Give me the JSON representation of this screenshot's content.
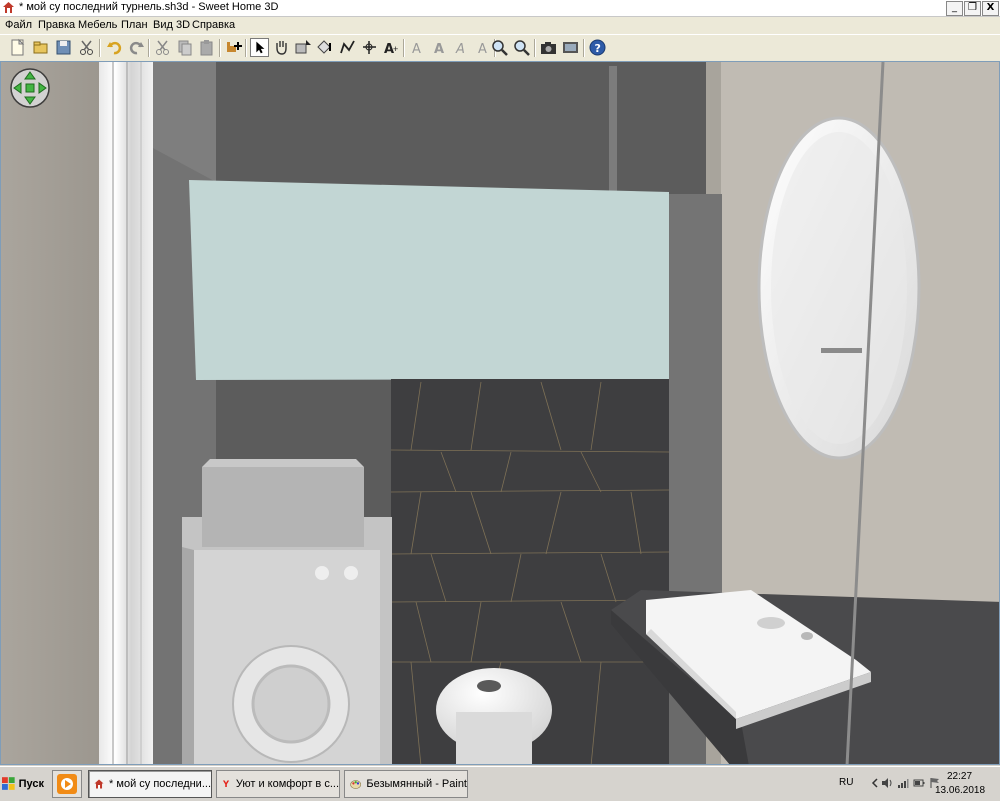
{
  "window": {
    "title": "* мой су последний турнель.sh3d - Sweet Home 3D",
    "controls": {
      "minimize": "_",
      "restore": "❐",
      "close": "X"
    }
  },
  "menu": {
    "items": [
      "Файл",
      "Правка",
      "Мебель",
      "План",
      "Вид 3D",
      "Справка"
    ]
  },
  "toolbar": {
    "buttons": [
      "new-file-icon",
      "open-file-icon",
      "save-file-icon",
      "cut-scissors-icon",
      "undo-icon",
      "redo-icon",
      "cut-icon",
      "copy-icon",
      "paste-icon",
      "add-furniture-icon",
      "select-arrow-icon",
      "pan-hand-icon",
      "create-walls-icon",
      "create-rooms-icon",
      "create-polylines-icon",
      "create-dimensions-icon",
      "add-text-icon",
      "text-style-icon",
      "text-bold-icon",
      "text-italic-icon",
      "text-size-icon",
      "zoom-in-icon",
      "zoom-out-icon",
      "create-photo-icon",
      "create-video-icon",
      "help-icon"
    ],
    "active_button": "select-arrow-icon"
  },
  "view3d": {
    "navigation_control": "navigation-arrows-icon",
    "colors": {
      "left_wall": "#a39e96",
      "back_dark_wall": "#5c5c5c",
      "window_glass": "#c2d6d4",
      "tile_wall": "#3e3e40",
      "appliance": "#d2d2d2",
      "right_wall": "#c0bbb3"
    }
  },
  "taskbar": {
    "start_label": "Пуск",
    "tasks": [
      {
        "label": "",
        "icon": "media-player-icon"
      },
      {
        "label": "* мой су последни...",
        "icon": "sweet-home-icon",
        "active": true
      },
      {
        "label": "Уют и комфорт в с...",
        "icon": "yandex-browser-icon"
      },
      {
        "label": "Безымянный - Paint",
        "icon": "paint-icon"
      }
    ],
    "tray": {
      "language": "RU",
      "time": "22:27",
      "date": "13.06.2018"
    }
  }
}
